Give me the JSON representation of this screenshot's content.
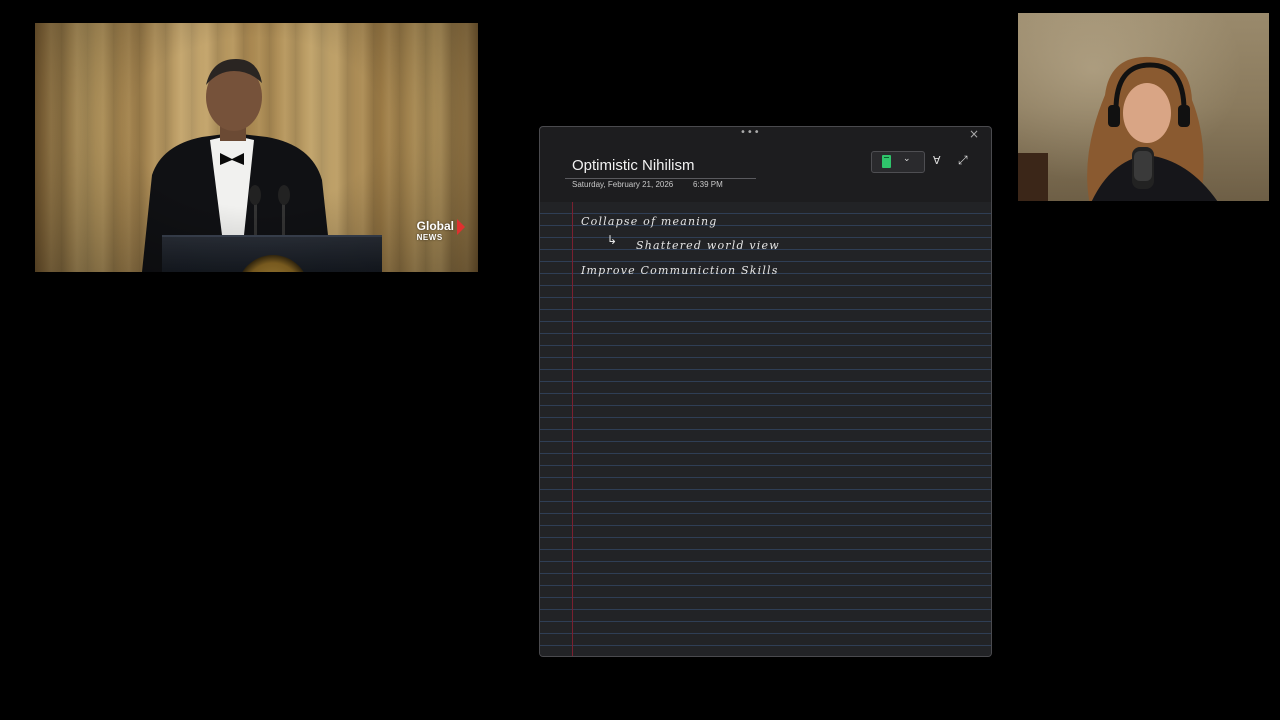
{
  "left_video": {
    "description_icon": "video-feed",
    "overlay_logo": {
      "line1": "Global",
      "line2": "NEWS"
    }
  },
  "webcam": {
    "description_icon": "webcam-feed"
  },
  "note": {
    "title": "Optimistic Nihilism",
    "date": "Saturday, February 21, 2026",
    "time": "6:39 PM",
    "drag_handle": "•••",
    "close_icon": "×",
    "notebook_color": "#2fc46b",
    "notebook_chevron": "⌄",
    "pen_icon": "∀",
    "expand_icon": "⤢",
    "handwriting": {
      "line1": "Collapse of meaning",
      "arrow": "↳",
      "line2": "Shattered world view",
      "line3": "Improve Communiction Skills"
    }
  }
}
